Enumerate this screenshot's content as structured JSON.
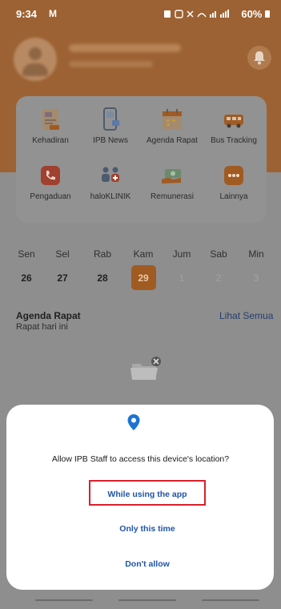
{
  "status_bar": {
    "time": "9:34",
    "mail_icon": "M",
    "battery": "60%"
  },
  "header": {
    "avatar_icon": "user-avatar-icon",
    "notification_icon": "bell-icon"
  },
  "menu": {
    "items": [
      {
        "label": "Kehadiran",
        "icon": "attendance-icon"
      },
      {
        "label": "IPB News",
        "icon": "news-phone-icon"
      },
      {
        "label": "Agenda Rapat",
        "icon": "calendar-icon"
      },
      {
        "label": "Bus Tracking",
        "icon": "bus-icon"
      },
      {
        "label": "Pengaduan",
        "icon": "phone-complaint-icon"
      },
      {
        "label": "haloKLINIK",
        "icon": "clinic-icon"
      },
      {
        "label": "Remunerasi",
        "icon": "money-icon"
      },
      {
        "label": "Lainnya",
        "icon": "more-icon"
      }
    ]
  },
  "calendar": {
    "days": [
      "Sen",
      "Sel",
      "Rab",
      "Kam",
      "Jum",
      "Sab",
      "Min"
    ],
    "dates": [
      "26",
      "27",
      "28",
      "29",
      "1",
      "2",
      "3"
    ],
    "selected": "29"
  },
  "agenda": {
    "title": "Agenda Rapat",
    "subtitle": "Rapat hari ini",
    "see_all": "Lihat Semua"
  },
  "permission": {
    "icon": "location-pin-icon",
    "prompt": "Allow IPB Staff to access this device's location?",
    "options": [
      "While using the app",
      "Only this time",
      "Don't allow"
    ],
    "highlighted": "While using the app"
  }
}
